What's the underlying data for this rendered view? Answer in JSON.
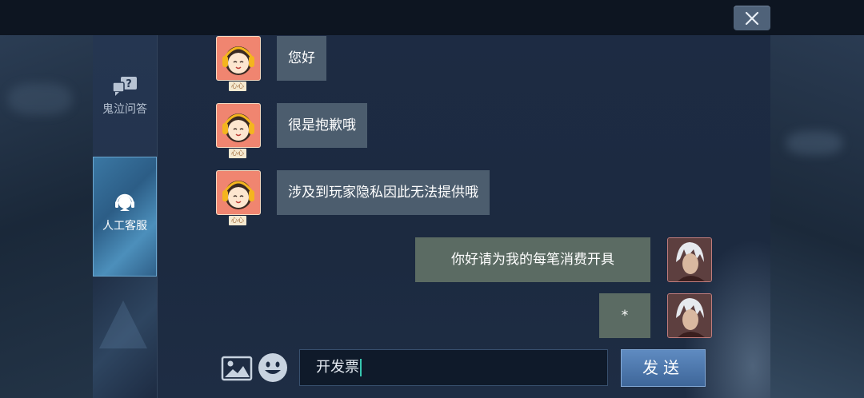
{
  "window": {
    "close_label": "×"
  },
  "sidebar": {
    "items": [
      {
        "label": "鬼泣问答",
        "icon": "question-bubble-icon",
        "active": false
      },
      {
        "label": "人工客服",
        "icon": "headset-icon",
        "active": true
      }
    ]
  },
  "chat": {
    "agent_name": "心心",
    "messages": [
      {
        "sender": "agent",
        "text": "您好"
      },
      {
        "sender": "agent",
        "text": "很是抱歉哦"
      },
      {
        "sender": "agent",
        "text": "涉及到玩家隐私因此无法提供哦"
      },
      {
        "sender": "user",
        "text": "你好请为我的每笔消费开具"
      },
      {
        "sender": "user",
        "text": "*"
      }
    ]
  },
  "composer": {
    "value": "开发票",
    "send_label": "发送",
    "image_icon": "image-icon",
    "emoji_icon": "emoji-icon"
  },
  "colors": {
    "agent_bubble": "#4c5d6e",
    "user_bubble": "#5b6b63",
    "active_tab": "#3b78a4",
    "send_button": "#4f78ad"
  }
}
